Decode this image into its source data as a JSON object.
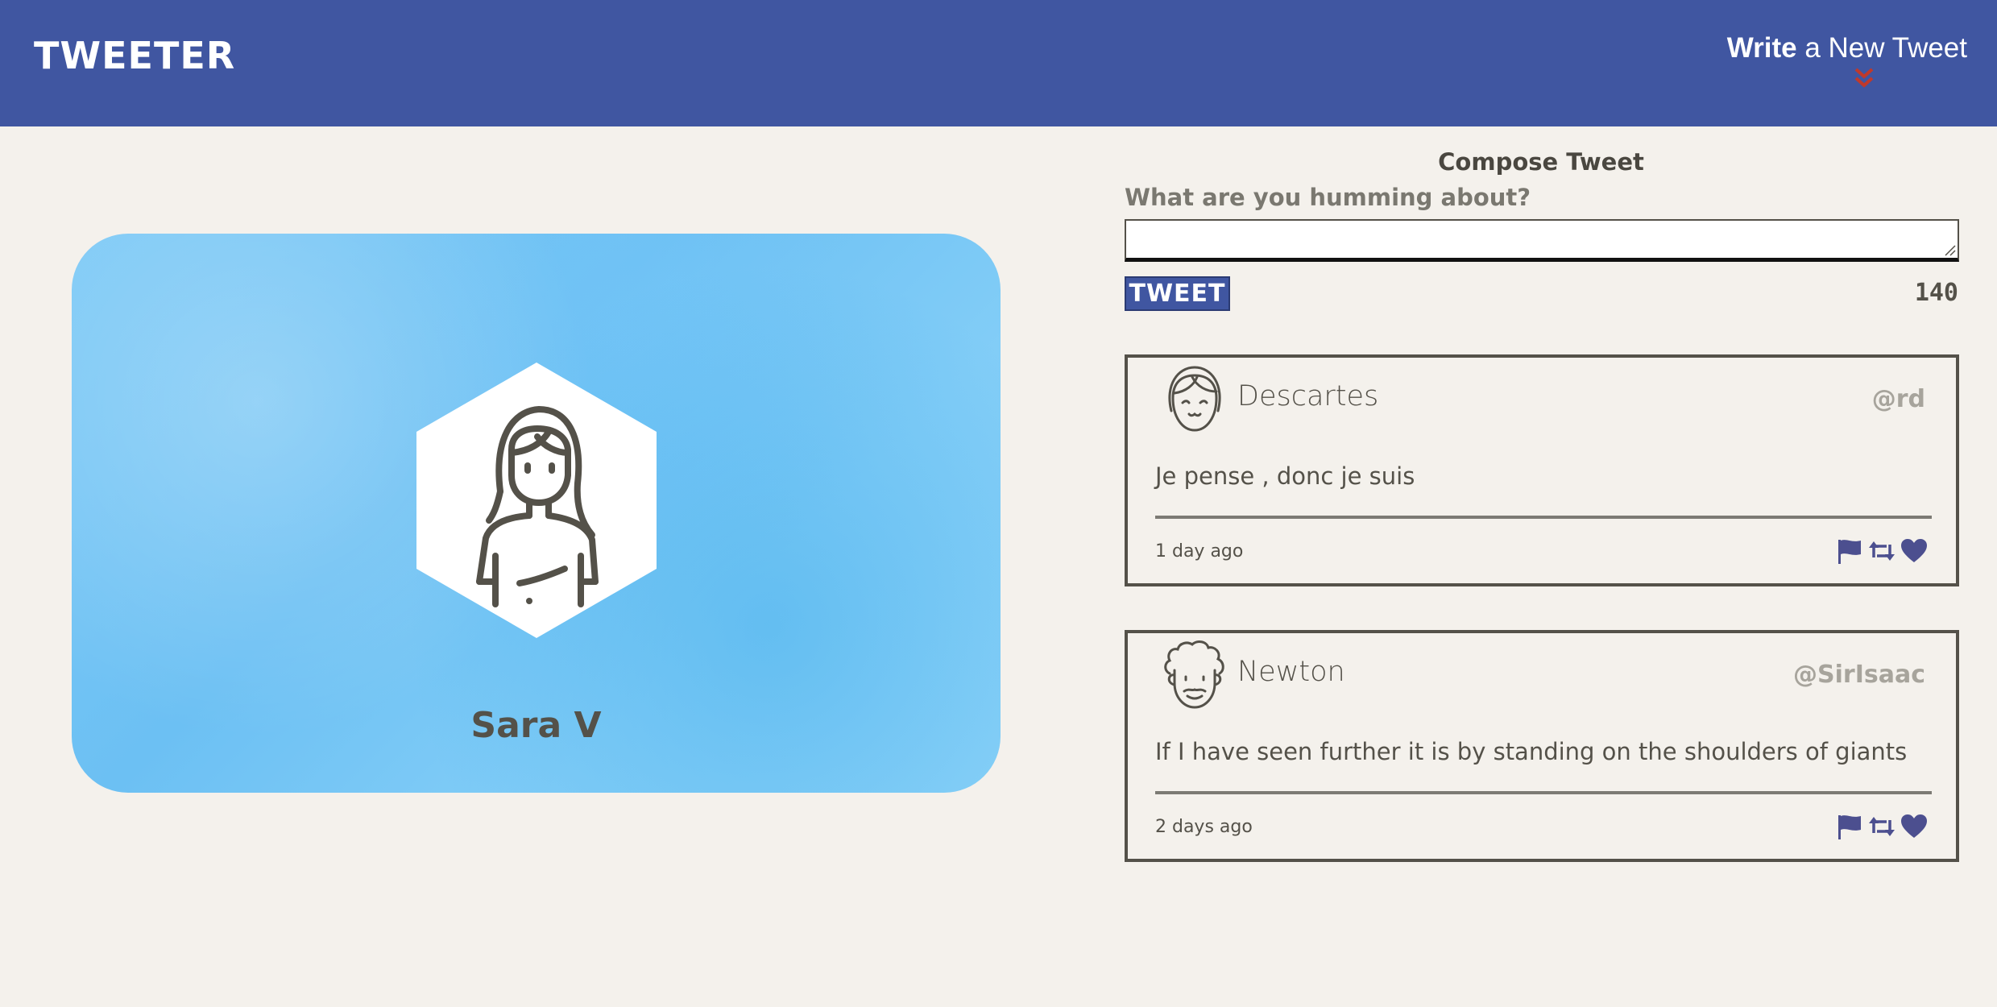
{
  "nav": {
    "brand": "TWEETER",
    "write_bold": "Write",
    "write_rest": " a New Tweet",
    "chevron_icon": "double-chevron-down-icon",
    "chevron_color": "#c0392b"
  },
  "profile": {
    "name": "Sara V",
    "avatar_icon": "woman-avatar-icon"
  },
  "compose": {
    "title": "Compose Tweet",
    "label": "What are you humming about?",
    "input_value": "",
    "button_label": "TWEET",
    "counter": "140"
  },
  "tweets": [
    {
      "name": "Descartes",
      "handle": "@rd",
      "content": "Je pense , donc je suis",
      "time": "1 day ago",
      "avatar_icon": "girl-avatar-icon"
    },
    {
      "name": "Newton",
      "handle": "@SirIsaac",
      "content": "If I have seen further it is by standing on the shoulders of giants",
      "time": "2 days ago",
      "avatar_icon": "curly-man-avatar-icon"
    }
  ],
  "colors": {
    "nav_bg": "#4056a1",
    "page_bg": "#f4f1ec",
    "action_icon": "#4c4f8f",
    "text": "#545149"
  }
}
